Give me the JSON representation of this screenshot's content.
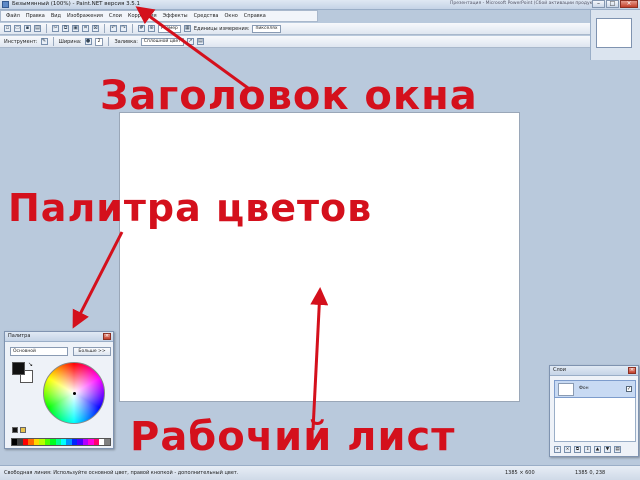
{
  "window": {
    "title": "Безымянный (100%) - Paint.NET версия 3.5.1",
    "subtitle": "Презентация - Microsoft PowerPoint (Сбой активации продукта)"
  },
  "menu": [
    "Файл",
    "Правка",
    "Вид",
    "Изображения",
    "Слои",
    "Коррекция",
    "Эффекты",
    "Средства",
    "Окно",
    "Справка"
  ],
  "toolbar1": {
    "window_mode_label": "Единицы измерения:",
    "units_value": "пикселях",
    "zoom_value": "Размер"
  },
  "toolbar2": {
    "tool_label": "Инструмент:",
    "width_label": "Ширина:",
    "width_value": "2",
    "antialias_label": "Заливка:",
    "fill_value": "Сплошной цвет"
  },
  "palette": {
    "title": "Палитра",
    "mode_value": "Основной",
    "more_button": "Больше >>",
    "swatches": [
      "#000000",
      "#404040",
      "#ff0000",
      "#ff6a00",
      "#ffd800",
      "#b6ff00",
      "#4cff00",
      "#00ff21",
      "#00ff90",
      "#00ffff",
      "#0094ff",
      "#0026ff",
      "#4800ff",
      "#b200ff",
      "#ff00dc",
      "#ff006e",
      "#ffffff",
      "#808080"
    ]
  },
  "layers": {
    "title": "Слои",
    "layer_name": "Фон"
  },
  "status": {
    "hint": "Свободная линия: Используйте основной цвет, правой кнопкой - дополнительный цвет.",
    "size": "1385 × 600",
    "position": "1385 0, 238"
  },
  "annotations": {
    "title_label": "Заголовок окна",
    "palette_label": "Палитра цветов",
    "sheet_label": "Рабочий лист"
  },
  "colors": {
    "annotation": "#d4101c",
    "workspace": "#b9c9dc"
  }
}
